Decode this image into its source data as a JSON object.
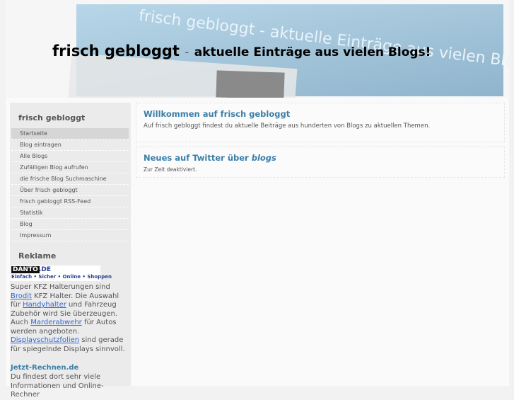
{
  "header": {
    "title": "frisch gebloggt",
    "separator": "-",
    "subtitle": "aktuelle Einträge aus vielen Blogs!",
    "banner_ghost": "frisch gebloggt - aktuelle Einträge aus vielen Blogs"
  },
  "sidebar": {
    "title": "frisch gebloggt",
    "items": [
      {
        "label": "Startseite"
      },
      {
        "label": "Blog eintragen"
      },
      {
        "label": "Alle Blogs"
      },
      {
        "label": "Zufälligen Blog aufrufen"
      },
      {
        "label": "die frische Blog Suchmaschine"
      },
      {
        "label": "Über frisch gebloggt"
      },
      {
        "label": "frisch gebloggt RSS-Feed"
      },
      {
        "label": "Statistik"
      },
      {
        "label": "Blog"
      },
      {
        "label": "Impressum"
      }
    ],
    "ad_heading": "Reklame",
    "ad": {
      "logo_main": "DANTO",
      "logo_tld": ".DE",
      "logo_tag": "Einfach • Sicher • Online • Shoppen",
      "t1": "Super KFZ Halterungen sind ",
      "l1": "Brodit",
      "t2": " KFZ Halter. Die Auswahl für ",
      "l2": "Handyhalter",
      "t3": " und Fahrzeug Zubehör wird Sie überzeugen. Auch ",
      "l3": "Marderabwehr",
      "t4": " für Autos werden angeboten. ",
      "l4": "Displayschutzfolien",
      "t5": " sind gerade für spiegelnde Displays sinnvoll."
    },
    "ad2_title": "Jetzt-Rechnen.de",
    "ad2_text": "Du findest dort sehr viele Informationen und Online-Rechner"
  },
  "main": {
    "welcome_title": "Willkommen auf frisch gebloggt",
    "welcome_text": "Auf frisch gebloggt findest du aktuelle Beiträge aus hunderten von Blogs zu aktuellen Themen.",
    "twitter_title": "Neues auf Twitter über ",
    "twitter_term": "blogs",
    "twitter_text": "Zur Zeit deaktiviert."
  }
}
